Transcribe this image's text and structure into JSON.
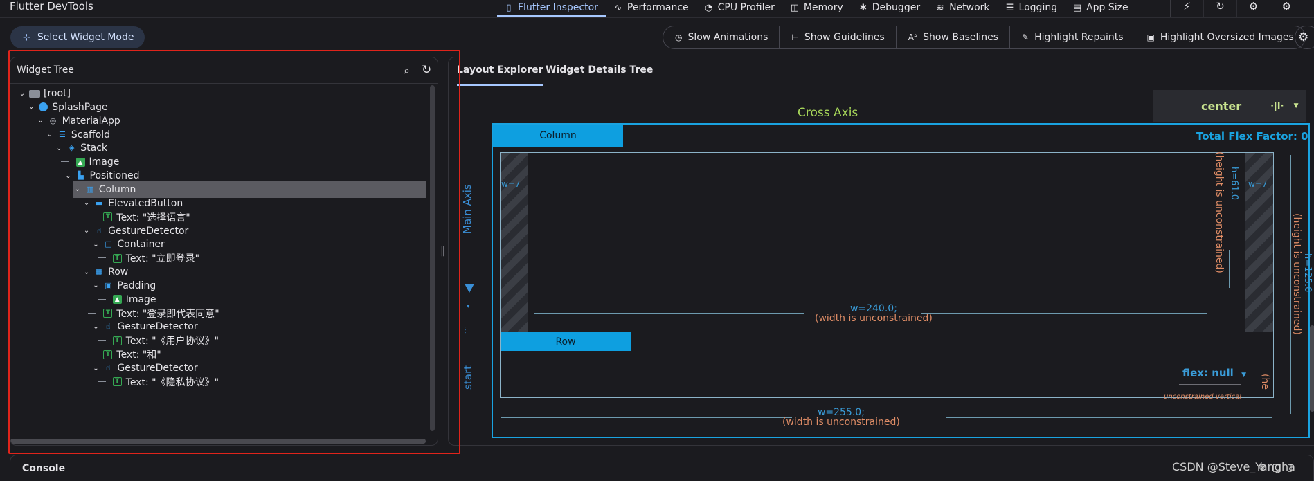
{
  "app": {
    "title": "Flutter DevTools"
  },
  "tabs": [
    {
      "label": "Flutter Inspector",
      "icon": "▯",
      "active": true
    },
    {
      "label": "Performance",
      "icon": "∿"
    },
    {
      "label": "CPU Profiler",
      "icon": "◔"
    },
    {
      "label": "Memory",
      "icon": "◫"
    },
    {
      "label": "Debugger",
      "icon": "✱"
    },
    {
      "label": "Network",
      "icon": "≋"
    },
    {
      "label": "Logging",
      "icon": "☰"
    },
    {
      "label": "App Size",
      "icon": "▤"
    }
  ],
  "top_actions": [
    {
      "name": "hot-reload-icon",
      "glyph": "⚡"
    },
    {
      "name": "hot-restart-icon",
      "glyph": "↻"
    },
    {
      "name": "settings-icon",
      "glyph": "⚙"
    },
    {
      "name": "extensions-icon",
      "glyph": "⚙"
    }
  ],
  "toolbar": {
    "select_widget_mode": "Select Widget Mode",
    "toggles": [
      {
        "label": "Slow Animations",
        "icon": "◷"
      },
      {
        "label": "Show Guidelines",
        "icon": "⊢"
      },
      {
        "label": "Show Baselines",
        "icon": "Aᴬ"
      },
      {
        "label": "Highlight Repaints",
        "icon": "✎"
      },
      {
        "label": "Highlight Oversized Images",
        "icon": "▣"
      }
    ],
    "settings_glyph": "⚙"
  },
  "widget_tree": {
    "title": "Widget Tree",
    "search_glyph": "⌕",
    "refresh_glyph": "↻",
    "rows": [
      {
        "label": "[root]",
        "depth": 0,
        "chevron": true,
        "icon": "folder"
      },
      {
        "label": "SplashPage",
        "depth": 1,
        "chevron": true,
        "icon": "blue-c"
      },
      {
        "label": "MaterialApp",
        "depth": 2,
        "chevron": true,
        "icon": "grey",
        "glyph": "◎"
      },
      {
        "label": "Scaffold",
        "depth": 3,
        "chevron": true,
        "icon": "blue",
        "glyph": "☰"
      },
      {
        "label": "Stack",
        "depth": 4,
        "chevron": true,
        "icon": "blue",
        "glyph": "◈"
      },
      {
        "label": "Image",
        "depth": 5,
        "chevron": false,
        "icon": "green",
        "glyph": "▲"
      },
      {
        "label": "Positioned",
        "depth": 5,
        "chevron": true,
        "icon": "blue",
        "glyph": "▙"
      },
      {
        "label": "Column",
        "depth": 6,
        "chevron": true,
        "icon": "blue",
        "glyph": "▥",
        "selected": true
      },
      {
        "label": "ElevatedButton",
        "depth": 7,
        "chevron": true,
        "icon": "blue",
        "glyph": "▬"
      },
      {
        "label": "Text: \"选择语言\"",
        "depth": 8,
        "chevron": false,
        "icon": "textT",
        "glyph": "T"
      },
      {
        "label": "GestureDetector",
        "depth": 7,
        "chevron": true,
        "icon": "blue",
        "glyph": "☝"
      },
      {
        "label": "Container",
        "depth": 8,
        "chevron": true,
        "icon": "blue",
        "glyph": "□"
      },
      {
        "label": "Text: \"立即登录\"",
        "depth": 9,
        "chevron": false,
        "icon": "textT",
        "glyph": "T"
      },
      {
        "label": "Row",
        "depth": 7,
        "chevron": true,
        "icon": "blue",
        "glyph": "▦"
      },
      {
        "label": "Padding",
        "depth": 8,
        "chevron": true,
        "icon": "blue",
        "glyph": "▣"
      },
      {
        "label": "Image",
        "depth": 9,
        "chevron": false,
        "icon": "green",
        "glyph": "▲"
      },
      {
        "label": "Text: \"登录即代表同意\"",
        "depth": 8,
        "chevron": false,
        "icon": "textT",
        "glyph": "T"
      },
      {
        "label": "GestureDetector",
        "depth": 8,
        "chevron": true,
        "icon": "blue",
        "glyph": "☝"
      },
      {
        "label": "Text: \"《用户协议》\"",
        "depth": 9,
        "chevron": false,
        "icon": "textT",
        "glyph": "T"
      },
      {
        "label": "Text: \"和\"",
        "depth": 8,
        "chevron": false,
        "icon": "textT",
        "glyph": "T"
      },
      {
        "label": "GestureDetector",
        "depth": 8,
        "chevron": true,
        "icon": "blue",
        "glyph": "☝"
      },
      {
        "label": "Text: \"《隐私协议》\"",
        "depth": 9,
        "chevron": false,
        "icon": "textT",
        "glyph": "T"
      }
    ]
  },
  "details": {
    "tabs": [
      "Layout Explorer",
      "Widget Details Tree"
    ],
    "cross_axis_label": "Cross Axis",
    "cross_axis_value": "center",
    "main_axis_label": "Main Axis",
    "main_axis_value": "start",
    "column_label": "Column",
    "row_label": "Row",
    "total_flex": "Total Flex Factor: 0",
    "w7_left": "w=7",
    "w7_right": "w=7",
    "h61": "h=61.0",
    "height_uncon_inner": "(height is unconstrained)",
    "w240": "w=240.0;",
    "w240_uncon": "(width is unconstrained)",
    "h125": "h=125.0",
    "height_uncon_outer": "(height is unconstrained)",
    "flex_null": "flex: null",
    "unconstrained_vertical": "unconstrained vertical",
    "row_height_partial": "(he",
    "w255": "w=255.0;",
    "w255_uncon": "(width is unconstrained)"
  },
  "console": {
    "title": "Console"
  },
  "watermark": "CSDN @Steve_Yangha"
}
